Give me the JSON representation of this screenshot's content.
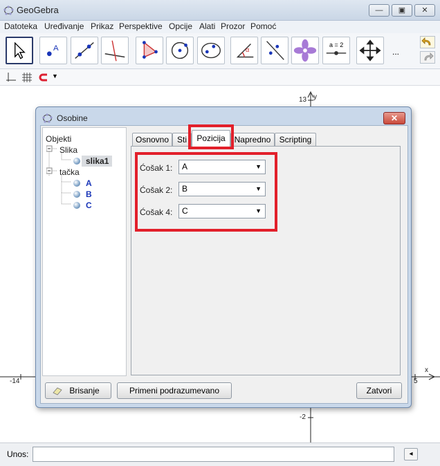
{
  "window": {
    "title": "GeoGebra"
  },
  "menu": [
    "Datoteka",
    "Uređivanje",
    "Prikaz",
    "Perspektive",
    "Opcije",
    "Alati",
    "Prozor",
    "Pomoć"
  ],
  "toolbar": {
    "more_label": "...",
    "slider_label": "a = 2"
  },
  "graphics": {
    "y_axis_label": "y",
    "x_axis_label": "x",
    "tick_13": "13",
    "tick_neg2": "-2",
    "tick_neg14": "-14",
    "tick_5": "5"
  },
  "input": {
    "label": "Unos:",
    "value": ""
  },
  "dialog": {
    "title": "Osobine",
    "tree": {
      "root": "Objekti",
      "group1": "Slika",
      "item1": "slika1",
      "group2": "tačka",
      "points": [
        "A",
        "B",
        "C"
      ]
    },
    "tabs": [
      "Osnovno",
      "Sti",
      "Pozicija",
      "Napredno",
      "Scripting"
    ],
    "active_tab": "Pozicija",
    "corners": [
      {
        "label": "Ćošak 1:",
        "value": "A"
      },
      {
        "label": "Ćošak 2:",
        "value": "B"
      },
      {
        "label": "Ćošak 4:",
        "value": "C"
      }
    ],
    "buttons": {
      "delete": "Brisanje",
      "defaults": "Primeni podrazumevano",
      "close": "Zatvori"
    }
  },
  "colors": {
    "highlight": "#e2202b",
    "point_blue": "#1a36b8",
    "dialog_frame": "#c9d8ea"
  }
}
